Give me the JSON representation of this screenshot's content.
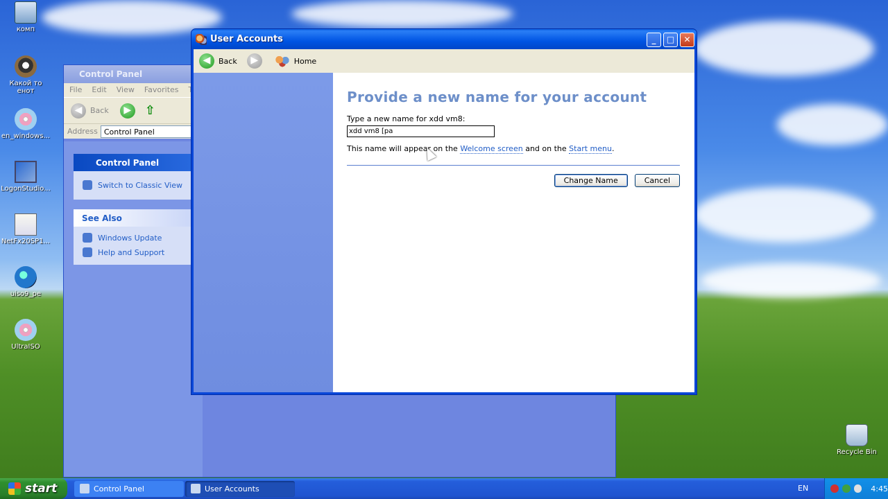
{
  "desktop": {
    "icons": [
      {
        "label": "комп",
        "icon": "computer-icon"
      },
      {
        "label": "Какой то енот",
        "icon": "raccoon-icon"
      },
      {
        "label": "en_windows...",
        "icon": "disc-icon"
      },
      {
        "label": "LogonStudio...",
        "icon": "logonstudio-icon"
      },
      {
        "label": "NetFx20SP1...",
        "icon": "setup-icon"
      },
      {
        "label": "uiso9_pe",
        "icon": "globe-icon"
      },
      {
        "label": "UltraISO",
        "icon": "ultraiso-icon"
      }
    ],
    "recycle_bin": "Recycle Bin"
  },
  "control_panel": {
    "title": "Control Panel",
    "menu": [
      "File",
      "Edit",
      "View",
      "Favorites",
      "T"
    ],
    "back": "Back",
    "address_label": "Address",
    "address_value": "Control Panel",
    "pane_title": "Control Panel",
    "switch_view": "Switch to Classic View",
    "see_also": "See Also",
    "links": [
      "Windows Update",
      "Help and Support"
    ]
  },
  "user_accounts": {
    "title": "User Accounts",
    "nav": {
      "back": "Back",
      "home": "Home"
    },
    "heading": "Provide a new name for your account",
    "prompt": "Type a new name for xdd vm8:",
    "name_value": "xdd vm8 [pa",
    "note_prefix": "This name will appear on the",
    "welcome_link": "Welcome screen",
    "note_middle": "and on the",
    "start_link": "Start menu",
    "note_suffix": ".",
    "change_button": "Change Name",
    "cancel_button": "Cancel"
  },
  "taskbar": {
    "start": "start",
    "tasks": [
      "Control Panel",
      "User Accounts"
    ],
    "language": "EN",
    "clock": "4:45"
  }
}
